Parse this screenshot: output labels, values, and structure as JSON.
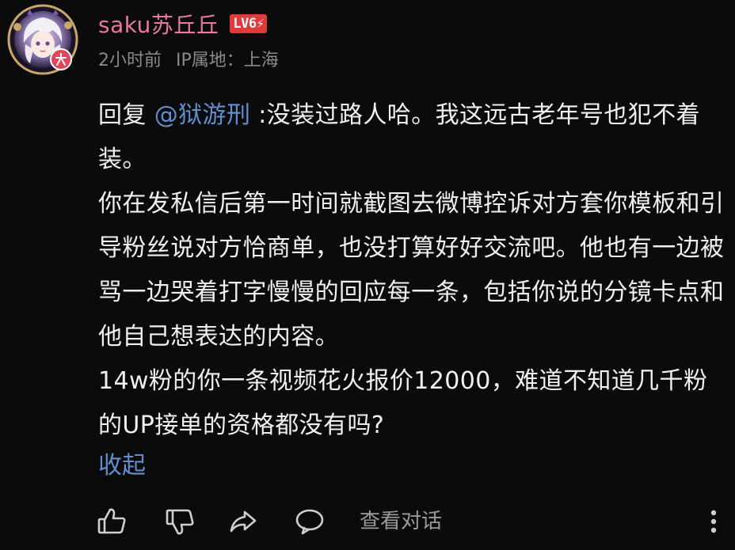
{
  "comment": {
    "username": "saku苏丘丘",
    "level_badge": "LV6⚡",
    "time_ago": "2小时前",
    "ip_location": "IP属地：上海",
    "reply_prefix": "回复 ",
    "mention": "@狱游刑",
    "paragraph1_rest": " :没装过路人哈。我这远古老年号也犯不着装。",
    "paragraph2": "你在发私信后第一时间就截图去微博控诉对方套你模板和引导粉丝说对方恰商单，也没打算好好交流吧。他也有一边被骂一边哭着打字慢慢的回应每一条，包括你说的分镜卡点和他自己想表达的内容。",
    "paragraph3": "14w粉的你一条视频花火报价12000，难道不知道几千粉的UP接单的资格都没有吗?",
    "collapse_label": "收起"
  },
  "actions": {
    "view_conversation": "查看对话",
    "icons": [
      "thumbs-up-icon",
      "thumbs-down-icon",
      "share-icon",
      "comment-icon",
      "more-vertical-icon"
    ]
  },
  "colors": {
    "background": "#0b0b0b",
    "username": "#e87a9d",
    "level_badge": "#e03a3a",
    "link": "#5e8fcf",
    "body_text": "#f0f0f0",
    "meta_text": "#8a8a8a"
  }
}
